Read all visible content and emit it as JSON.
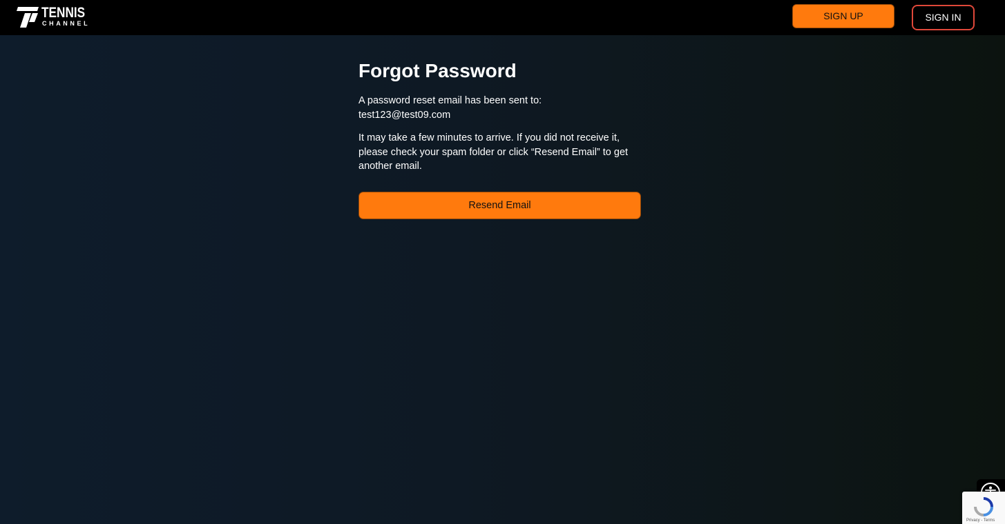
{
  "header": {
    "logo": {
      "wordmark": "TENNIS",
      "subtext": "CHANNEL",
      "icon": "tennis-channel-t-icon"
    },
    "signup_label": "SIGN UP",
    "signin_label": "SIGN IN"
  },
  "main": {
    "title": "Forgot Password",
    "sent_message": "A password reset email has been sent to:",
    "email": "test123@test09.com",
    "info_message": "It may take a few minutes to arrive. If you did not receive it, please check your spam folder or click “Resend Email” to get another email.",
    "resend_label": "Resend Email"
  },
  "widgets": {
    "accessibility_icon": "accessibility-icon",
    "recaptcha_text": "Privacy - Terms"
  },
  "colors": {
    "accent": "#ff7a0d",
    "signin_border": "#e0483a",
    "topbar": "#000000"
  }
}
